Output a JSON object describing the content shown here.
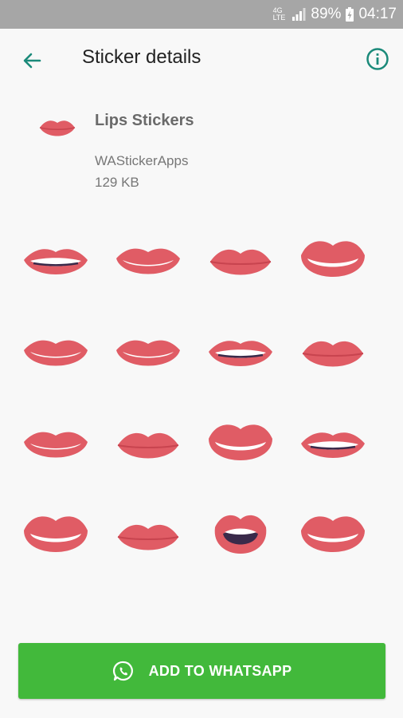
{
  "status_bar": {
    "network": "4G",
    "network_sub": "LTE",
    "battery": "89%",
    "time": "04:17"
  },
  "header": {
    "title": "Sticker details",
    "back_icon": "arrow-back-icon",
    "info_icon": "info-icon"
  },
  "pack": {
    "name": "Lips Stickers",
    "publisher": "WAStickerApps",
    "size": "129 KB"
  },
  "stickers": [
    "lips-smile-grin",
    "lips-smile-teeth",
    "lips-closed",
    "lips-big-smile",
    "lips-wide-smile",
    "lips-smile-teeth",
    "lips-grin-teeth",
    "lips-closed-flat",
    "lips-wide-smile",
    "lips-pout",
    "lips-big-open-smile",
    "lips-grin-smirk",
    "lips-open-smile",
    "lips-closed-flat",
    "lips-open-mouth",
    "lips-teeth-smile"
  ],
  "add_button": {
    "label": "ADD TO WHATSAPP",
    "icon": "whatsapp-icon"
  },
  "colors": {
    "lip": "#e05c65",
    "lip_dark": "#c8444f",
    "teeth": "#ffffff",
    "mouth": "#3a2a4a",
    "accent": "#1b8a7a",
    "button": "#42b93b"
  }
}
